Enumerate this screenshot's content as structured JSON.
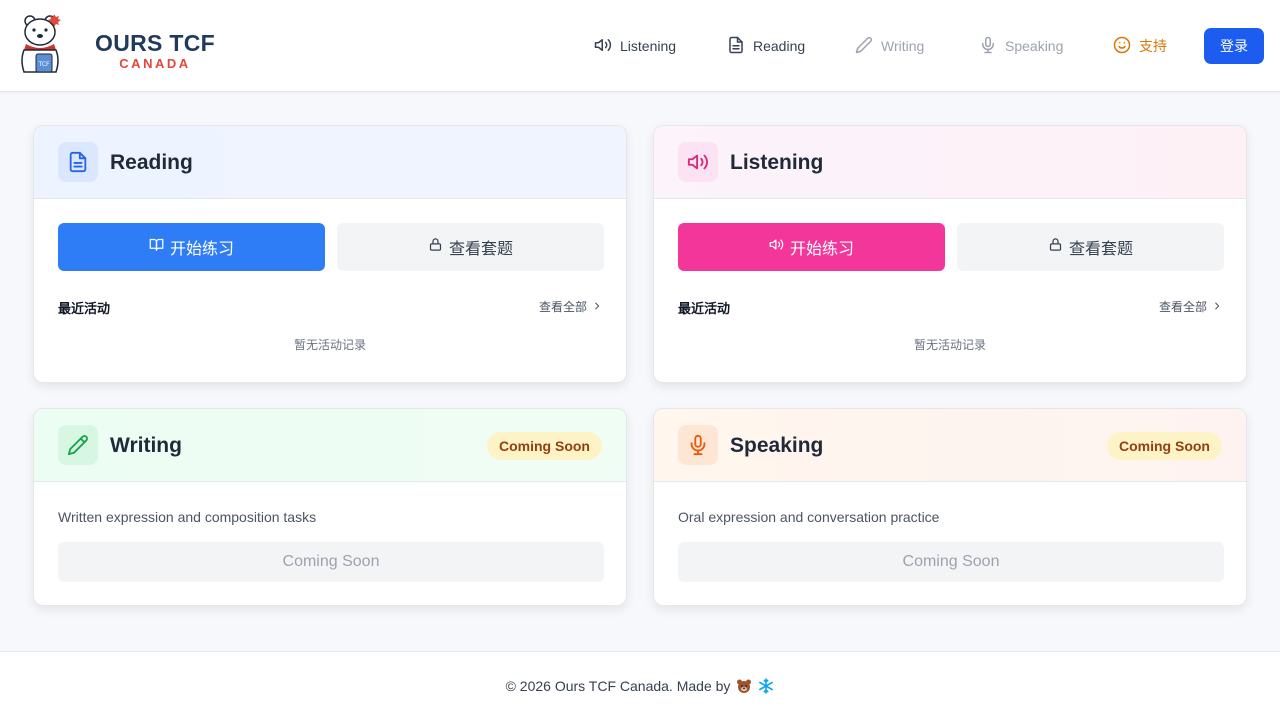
{
  "brand": {
    "name": "OURS TCF",
    "sub": "CANADA",
    "logo_icon": "polar-bear-mascot"
  },
  "nav": {
    "listening": "Listening",
    "reading": "Reading",
    "writing": "Writing",
    "speaking": "Speaking",
    "support": "支持",
    "login": "登录"
  },
  "cards": {
    "reading": {
      "title": "Reading",
      "start": "开始练习",
      "view_sets": "查看套题",
      "recent": "最近活动",
      "view_all": "查看全部",
      "empty": "暂无活动记录"
    },
    "listening": {
      "title": "Listening",
      "start": "开始练习",
      "view_sets": "查看套题",
      "recent": "最近活动",
      "view_all": "查看全部",
      "empty": "暂无活动记录"
    },
    "writing": {
      "title": "Writing",
      "badge": "Coming Soon",
      "desc": "Written expression and composition tasks",
      "button": "Coming Soon"
    },
    "speaking": {
      "title": "Speaking",
      "badge": "Coming Soon",
      "desc": "Oral expression and conversation practice",
      "button": "Coming Soon"
    }
  },
  "footer": {
    "text": "© 2026 Ours TCF Canada. Made by"
  },
  "colors": {
    "primary_blue": "#2f7df6",
    "primary_pink": "#f2369a",
    "login_blue": "#1d5cf0",
    "brand_navy": "#1f3a5a",
    "brand_red": "#e0483c"
  }
}
